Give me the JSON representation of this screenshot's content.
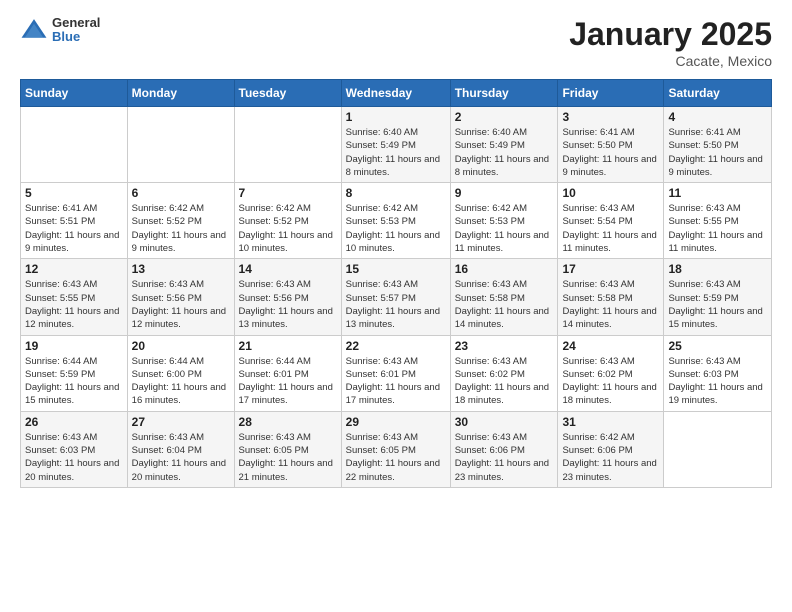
{
  "header": {
    "logo_general": "General",
    "logo_blue": "Blue",
    "month_title": "January 2025",
    "location": "Cacate, Mexico"
  },
  "weekdays": [
    "Sunday",
    "Monday",
    "Tuesday",
    "Wednesday",
    "Thursday",
    "Friday",
    "Saturday"
  ],
  "weeks": [
    [
      {
        "day": "",
        "sunrise": "",
        "sunset": "",
        "daylight": ""
      },
      {
        "day": "",
        "sunrise": "",
        "sunset": "",
        "daylight": ""
      },
      {
        "day": "",
        "sunrise": "",
        "sunset": "",
        "daylight": ""
      },
      {
        "day": "1",
        "sunrise": "Sunrise: 6:40 AM",
        "sunset": "Sunset: 5:49 PM",
        "daylight": "Daylight: 11 hours and 8 minutes."
      },
      {
        "day": "2",
        "sunrise": "Sunrise: 6:40 AM",
        "sunset": "Sunset: 5:49 PM",
        "daylight": "Daylight: 11 hours and 8 minutes."
      },
      {
        "day": "3",
        "sunrise": "Sunrise: 6:41 AM",
        "sunset": "Sunset: 5:50 PM",
        "daylight": "Daylight: 11 hours and 9 minutes."
      },
      {
        "day": "4",
        "sunrise": "Sunrise: 6:41 AM",
        "sunset": "Sunset: 5:50 PM",
        "daylight": "Daylight: 11 hours and 9 minutes."
      }
    ],
    [
      {
        "day": "5",
        "sunrise": "Sunrise: 6:41 AM",
        "sunset": "Sunset: 5:51 PM",
        "daylight": "Daylight: 11 hours and 9 minutes."
      },
      {
        "day": "6",
        "sunrise": "Sunrise: 6:42 AM",
        "sunset": "Sunset: 5:52 PM",
        "daylight": "Daylight: 11 hours and 9 minutes."
      },
      {
        "day": "7",
        "sunrise": "Sunrise: 6:42 AM",
        "sunset": "Sunset: 5:52 PM",
        "daylight": "Daylight: 11 hours and 10 minutes."
      },
      {
        "day": "8",
        "sunrise": "Sunrise: 6:42 AM",
        "sunset": "Sunset: 5:53 PM",
        "daylight": "Daylight: 11 hours and 10 minutes."
      },
      {
        "day": "9",
        "sunrise": "Sunrise: 6:42 AM",
        "sunset": "Sunset: 5:53 PM",
        "daylight": "Daylight: 11 hours and 11 minutes."
      },
      {
        "day": "10",
        "sunrise": "Sunrise: 6:43 AM",
        "sunset": "Sunset: 5:54 PM",
        "daylight": "Daylight: 11 hours and 11 minutes."
      },
      {
        "day": "11",
        "sunrise": "Sunrise: 6:43 AM",
        "sunset": "Sunset: 5:55 PM",
        "daylight": "Daylight: 11 hours and 11 minutes."
      }
    ],
    [
      {
        "day": "12",
        "sunrise": "Sunrise: 6:43 AM",
        "sunset": "Sunset: 5:55 PM",
        "daylight": "Daylight: 11 hours and 12 minutes."
      },
      {
        "day": "13",
        "sunrise": "Sunrise: 6:43 AM",
        "sunset": "Sunset: 5:56 PM",
        "daylight": "Daylight: 11 hours and 12 minutes."
      },
      {
        "day": "14",
        "sunrise": "Sunrise: 6:43 AM",
        "sunset": "Sunset: 5:56 PM",
        "daylight": "Daylight: 11 hours and 13 minutes."
      },
      {
        "day": "15",
        "sunrise": "Sunrise: 6:43 AM",
        "sunset": "Sunset: 5:57 PM",
        "daylight": "Daylight: 11 hours and 13 minutes."
      },
      {
        "day": "16",
        "sunrise": "Sunrise: 6:43 AM",
        "sunset": "Sunset: 5:58 PM",
        "daylight": "Daylight: 11 hours and 14 minutes."
      },
      {
        "day": "17",
        "sunrise": "Sunrise: 6:43 AM",
        "sunset": "Sunset: 5:58 PM",
        "daylight": "Daylight: 11 hours and 14 minutes."
      },
      {
        "day": "18",
        "sunrise": "Sunrise: 6:43 AM",
        "sunset": "Sunset: 5:59 PM",
        "daylight": "Daylight: 11 hours and 15 minutes."
      }
    ],
    [
      {
        "day": "19",
        "sunrise": "Sunrise: 6:44 AM",
        "sunset": "Sunset: 5:59 PM",
        "daylight": "Daylight: 11 hours and 15 minutes."
      },
      {
        "day": "20",
        "sunrise": "Sunrise: 6:44 AM",
        "sunset": "Sunset: 6:00 PM",
        "daylight": "Daylight: 11 hours and 16 minutes."
      },
      {
        "day": "21",
        "sunrise": "Sunrise: 6:44 AM",
        "sunset": "Sunset: 6:01 PM",
        "daylight": "Daylight: 11 hours and 17 minutes."
      },
      {
        "day": "22",
        "sunrise": "Sunrise: 6:43 AM",
        "sunset": "Sunset: 6:01 PM",
        "daylight": "Daylight: 11 hours and 17 minutes."
      },
      {
        "day": "23",
        "sunrise": "Sunrise: 6:43 AM",
        "sunset": "Sunset: 6:02 PM",
        "daylight": "Daylight: 11 hours and 18 minutes."
      },
      {
        "day": "24",
        "sunrise": "Sunrise: 6:43 AM",
        "sunset": "Sunset: 6:02 PM",
        "daylight": "Daylight: 11 hours and 18 minutes."
      },
      {
        "day": "25",
        "sunrise": "Sunrise: 6:43 AM",
        "sunset": "Sunset: 6:03 PM",
        "daylight": "Daylight: 11 hours and 19 minutes."
      }
    ],
    [
      {
        "day": "26",
        "sunrise": "Sunrise: 6:43 AM",
        "sunset": "Sunset: 6:03 PM",
        "daylight": "Daylight: 11 hours and 20 minutes."
      },
      {
        "day": "27",
        "sunrise": "Sunrise: 6:43 AM",
        "sunset": "Sunset: 6:04 PM",
        "daylight": "Daylight: 11 hours and 20 minutes."
      },
      {
        "day": "28",
        "sunrise": "Sunrise: 6:43 AM",
        "sunset": "Sunset: 6:05 PM",
        "daylight": "Daylight: 11 hours and 21 minutes."
      },
      {
        "day": "29",
        "sunrise": "Sunrise: 6:43 AM",
        "sunset": "Sunset: 6:05 PM",
        "daylight": "Daylight: 11 hours and 22 minutes."
      },
      {
        "day": "30",
        "sunrise": "Sunrise: 6:43 AM",
        "sunset": "Sunset: 6:06 PM",
        "daylight": "Daylight: 11 hours and 23 minutes."
      },
      {
        "day": "31",
        "sunrise": "Sunrise: 6:42 AM",
        "sunset": "Sunset: 6:06 PM",
        "daylight": "Daylight: 11 hours and 23 minutes."
      },
      {
        "day": "",
        "sunrise": "",
        "sunset": "",
        "daylight": ""
      }
    ]
  ]
}
